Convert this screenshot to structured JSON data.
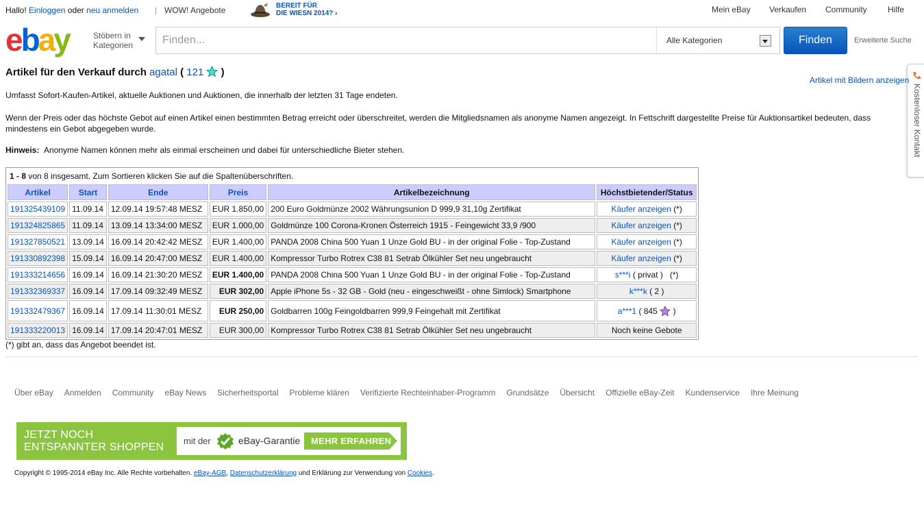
{
  "topbar": {
    "hello": "Hallo!",
    "login": "Einloggen",
    "or": "oder",
    "register": "neu anmelden",
    "separator": "|",
    "wow": "WOW! Angebote",
    "wiesn_line1": "BEREIT FÜR",
    "wiesn_line2": "DIE WIESN 2014?",
    "wiesn_chevron": "›",
    "nav": [
      "Mein eBay",
      "Verkaufen",
      "Community",
      "Hilfe"
    ]
  },
  "header": {
    "browse_line1": "Stöbern in",
    "browse_line2": "Kategorien",
    "search_placeholder": "Finden...",
    "category": "Alle Kategorien",
    "find": "Finden",
    "advanced": "Erweiterte Suche"
  },
  "sidetab": {
    "label": "Kostenloser Kontakt"
  },
  "content": {
    "title_prefix": "Artikel für den Verkauf durch",
    "seller": "agatal",
    "paren_open": "(",
    "feedback": "121",
    "paren_close": ")",
    "with_pictures": "Artikel mit Bildern anzeigen",
    "intro": "Umfasst Sofort-Kaufen-Artikel, aktuelle Auktionen und Auktionen, die innerhalb der letzten 31 Tage endeten.",
    "info": "Wenn der Preis oder das höchste Gebot auf einen Artikel einen bestimmten Betrag erreicht oder überschreitet, werden die Mitgliedsnamen als anonyme Namen angezeigt. In Fettschrift dargestellte Preise für Auktionsartikel bedeuten, dass mindestens ein Gebot abgegeben wurde.",
    "hint_label": "Hinweis:",
    "hint": "Anonyme Namen können mehr als einmal erscheinen und dabei für unterschiedliche Bieter stehen.",
    "note": "(*) gibt an, dass das Angebot beendet ist."
  },
  "table": {
    "range": "1 - 8",
    "count_text": "von 8 insgesamt. Zum Sortieren klicken Sie auf die Spaltenüberschriften.",
    "headers": [
      "Artikel",
      "Start",
      "Ende",
      "Preis",
      "Artikelbezeichnung",
      "Höchstbietender/Status"
    ],
    "rows": [
      {
        "id": "191325439109",
        "start": "11.09.14",
        "end": "12.09.14 19:57:48 MESZ",
        "price": "EUR 1.850,00",
        "bold": false,
        "title": "200 Euro Goldmünze 2002 Währungsunion D 999,9 31,10g Zertifikat",
        "status_link": "Käufer anzeigen",
        "status_suffix": "(*)"
      },
      {
        "id": "191324825865",
        "start": "11.09.14",
        "end": "13.09.14 13:34:00 MESZ",
        "price": "EUR 1.000,00",
        "bold": false,
        "title": "Goldmünze 100 Corona-Kronen Österreich 1915 - Feingewicht 33,9 /900",
        "status_link": "Käufer anzeigen",
        "status_suffix": "(*)"
      },
      {
        "id": "191327850521",
        "start": "13.09.14",
        "end": "16.09.14 20:42:42 MESZ",
        "price": "EUR 1.400,00",
        "bold": false,
        "title": "PANDA 2008 China 500 Yuan 1 Unze Gold BU - in der original Folie - Top-Zustand",
        "status_link": "Käufer anzeigen",
        "status_suffix": "(*)"
      },
      {
        "id": "191330892398",
        "start": "15.09.14",
        "end": "16.09.14 20:47:00 MESZ",
        "price": "EUR 1.400,00",
        "bold": false,
        "title": "Kompressor Turbo Rotrex C38 81 Setrab Ölkühler Set neu ungebraucht",
        "status_link": "Käufer anzeigen",
        "status_suffix": "(*)"
      },
      {
        "id": "191333214656",
        "start": "16.09.14",
        "end": "16.09.14 21:30:20 MESZ",
        "price": "EUR 1.400,00",
        "bold": true,
        "title": "PANDA 2008 China 500 Yuan 1 Unze Gold BU - in der original Folie - Top-Zustand",
        "status_link": "s***i",
        "status_suffix": "( privat )   (*)"
      },
      {
        "id": "191332369337",
        "start": "16.09.14",
        "end": "17.09.14 09:32:49 MESZ",
        "price": "EUR 302,00",
        "bold": true,
        "title": "Apple iPhone 5s - 32 GB - Gold (neu - eingeschweißt - ohne Simlock) Smartphone",
        "status_link": "k***k",
        "status_suffix": "( 2 )"
      },
      {
        "id": "191332479367",
        "start": "16.09.14",
        "end": "17.09.14 11:30:01 MESZ",
        "price": "EUR 250,00",
        "bold": true,
        "title": "Goldbarren 100g Feingoldbarren 999,9 Feingehalt mit Zertifikat",
        "status_link": "a***1",
        "status_suffix": "( 845",
        "status_star": true,
        "status_close": ")"
      },
      {
        "id": "191333220013",
        "start": "16.09.14",
        "end": "17.09.14 20:47:01 MESZ",
        "price": "EUR 300,00",
        "bold": false,
        "title": "Kompressor Turbo Rotrex C38 81 Setrab Ölkühler Set neu ungebraucht",
        "status_text": "Noch keine Gebote"
      }
    ]
  },
  "footer": {
    "links": [
      "Über eBay",
      "Anmelden",
      "Community",
      "eBay News",
      "Sicherheitsportal",
      "Probleme klären",
      "Verifizierte Rechteinhaber-Programm",
      "Grundsätze",
      "Übersicht",
      "Offizielle eBay-Zeit",
      "Kundenservice",
      "Ihre Meinung"
    ],
    "banner_line1": "JETZT NOCH",
    "banner_line2": "ENTSPANNTER SHOPPEN",
    "banner_mit": "mit der",
    "banner_garantie": "eBay-Garantie",
    "banner_more": "MEHR ERFAHREN",
    "copyright_text": "Copyright © 1995-2014 eBay Inc. Alle Rechte vorbehalten.",
    "agb": "eBay-AGB",
    "comma": ",",
    "privacy": "Datenschutzerklärung",
    "and": "und Erklärung zur Verwendung von",
    "cookies": "Cookies",
    "period": "."
  },
  "colors": {
    "link": "#0654ba",
    "header_bg": "#ccccff",
    "row_alt": "#eeeeee",
    "banner_green": "#8bc53f",
    "find_button": "#0654ba"
  }
}
